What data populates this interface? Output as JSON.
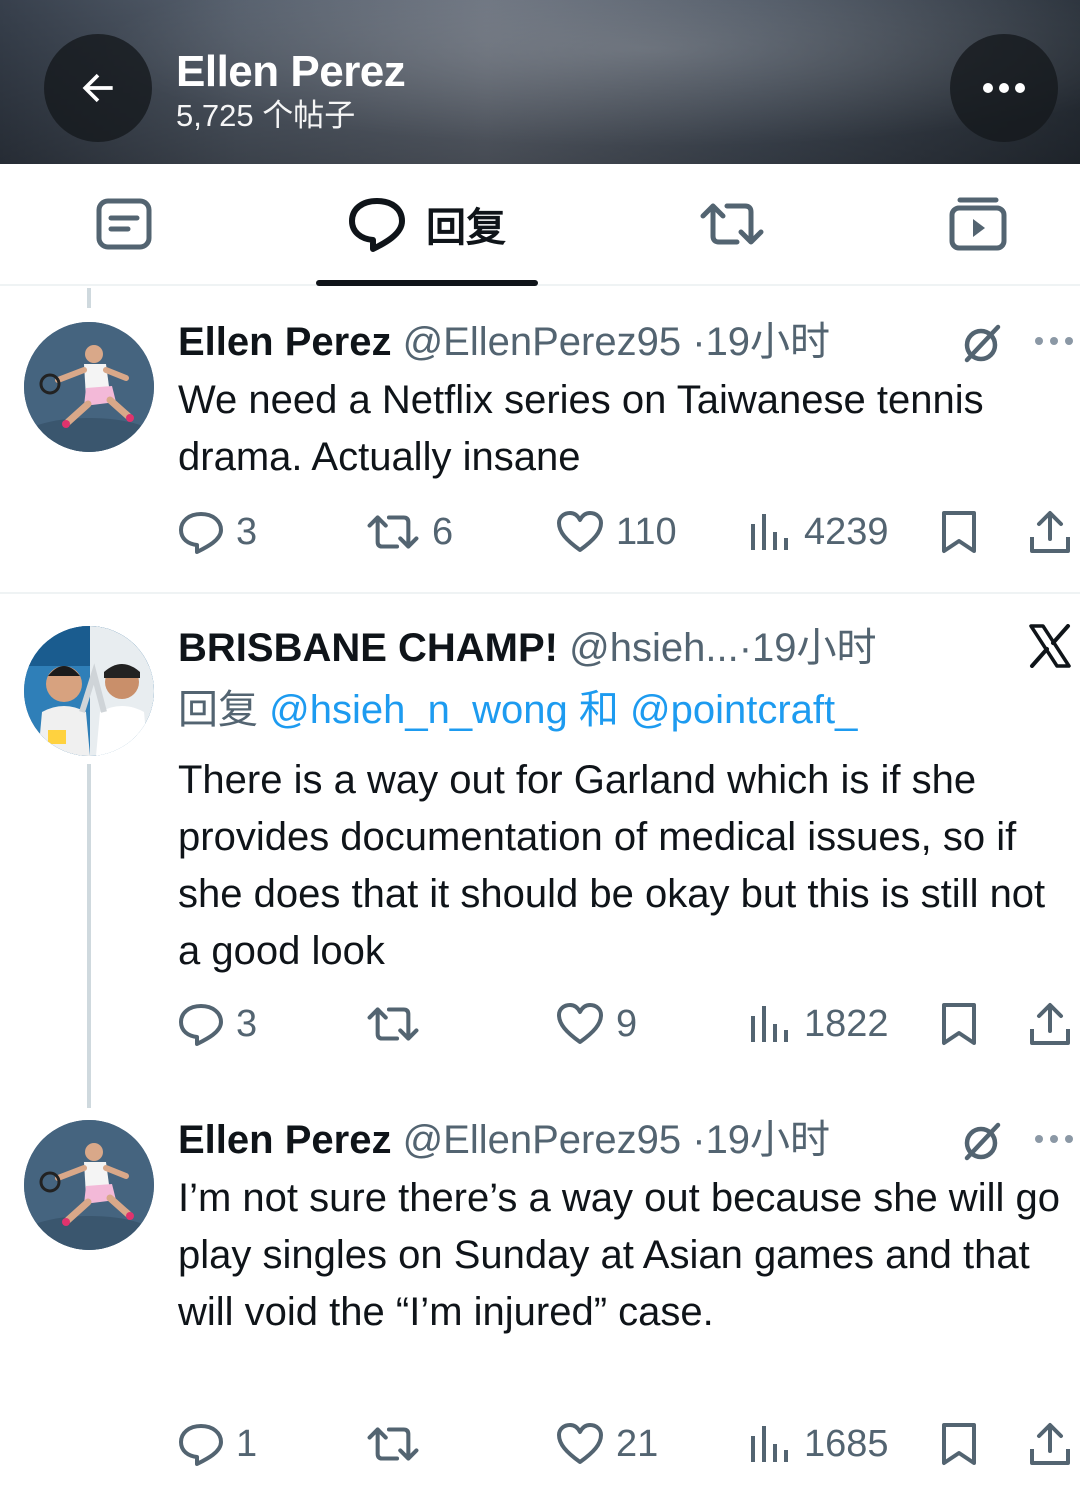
{
  "header": {
    "name": "Ellen Perez",
    "post_count": "5,725 个帖子",
    "back_icon": "arrow-left-icon",
    "more_icon": "more-dots-icon"
  },
  "tabs": [
    {
      "id": "posts",
      "icon": "posts-icon",
      "label": "",
      "selected": false
    },
    {
      "id": "replies",
      "icon": "reply-bubble-icon",
      "label": "回复",
      "selected": true
    },
    {
      "id": "reposts",
      "icon": "repost-icon",
      "label": "",
      "selected": false
    },
    {
      "id": "media",
      "icon": "media-play-icon",
      "label": "",
      "selected": false
    }
  ],
  "tweets": [
    {
      "name": "Ellen Perez",
      "handle": "@EllenPerez95",
      "sep": "·",
      "time": "19小时",
      "text": "We need a Netflix series on Taiwanese tennis drama. Actually insane",
      "replies": "3",
      "reposts": "6",
      "likes": "110",
      "views": "4239"
    },
    {
      "name": "BRISBANE CHAMP!",
      "handle": "@hsieh...",
      "sep": "·",
      "time": "19小时",
      "reply_prefix": "回复",
      "reply_mention_1": "@hsieh_n_wong",
      "reply_and": "和",
      "reply_mention_2": "@pointcraft_",
      "text": "There is a way out for Garland which is if she provides documentation of medical issues, so if she does that it should be okay but this is still not a good look",
      "replies": "3",
      "reposts": "",
      "likes": "9",
      "views": "1822"
    },
    {
      "name": "Ellen Perez",
      "handle": "@EllenPerez95",
      "sep": "·",
      "time": "19小时",
      "text": "I’m not sure there’s a way out because she will go play singles on Sunday at Asian games and that will void the “I’m injured” case.",
      "replies": "1",
      "reposts": "",
      "likes": "21",
      "views": "1685"
    }
  ],
  "colors": {
    "text": "#0f1419",
    "secondary": "#536471",
    "link": "#1d9bf0",
    "divider": "#eff3f4",
    "thread_line": "#cfd9de"
  }
}
